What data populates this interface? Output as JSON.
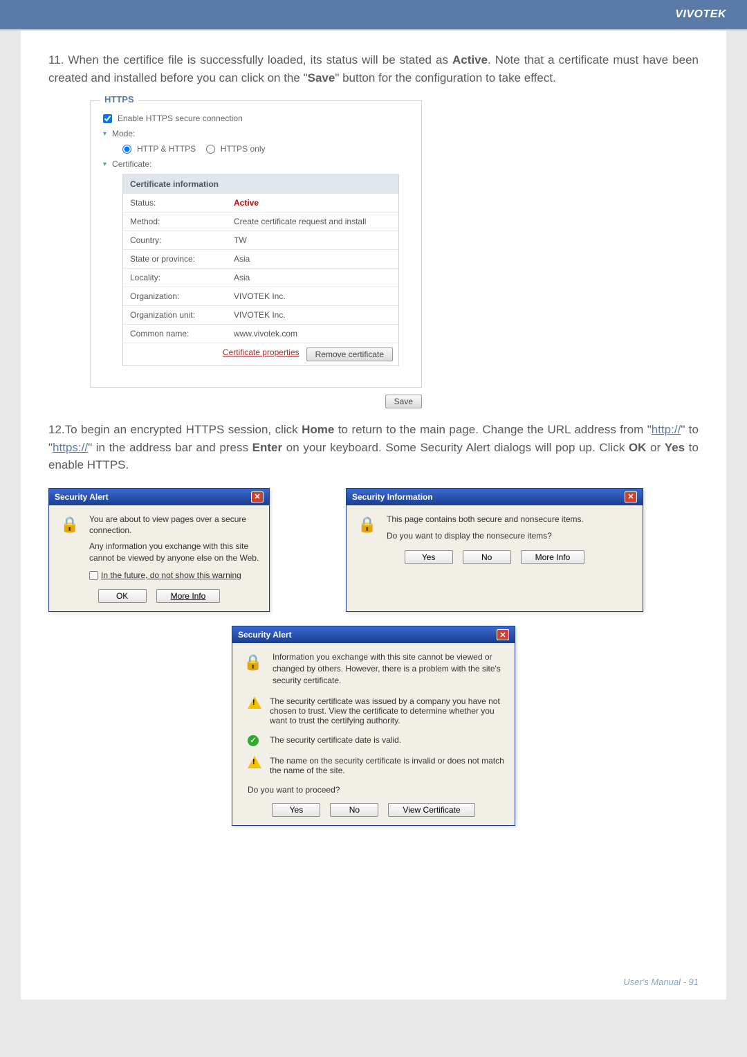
{
  "brand": "VIVOTEK",
  "step11": {
    "num": "11.",
    "text_a": " When the certifice file is successfully loaded, its status will be stated as ",
    "active": "Active",
    "text_b": ". Note that a certificate must have been created and installed before you can click on the \"",
    "save": "Save",
    "text_c": "\" button for the configuration to take effect."
  },
  "https_panel": {
    "legend": "HTTPS",
    "enable_label": "Enable HTTPS secure connection",
    "mode_label": "Mode:",
    "mode_http_https": "HTTP & HTTPS",
    "mode_https_only": "HTTPS only",
    "cert_label": "Certificate:",
    "cert_header": "Certificate information",
    "rows": [
      {
        "k": "Status:",
        "v": "Active",
        "active": true
      },
      {
        "k": "Method:",
        "v": "Create certificate request and install"
      },
      {
        "k": "Country:",
        "v": "TW"
      },
      {
        "k": "State or province:",
        "v": "Asia"
      },
      {
        "k": "Locality:",
        "v": "Asia"
      },
      {
        "k": "Organization:",
        "v": "VIVOTEK Inc."
      },
      {
        "k": "Organization unit:",
        "v": "VIVOTEK Inc."
      },
      {
        "k": "Common name:",
        "v": "www.vivotek.com"
      }
    ],
    "link_cert_props": "Certificate properties",
    "btn_remove": "Remove certificate",
    "btn_save": "Save"
  },
  "step12": {
    "num": "12.",
    "a": "To begin an encrypted HTTPS session, click ",
    "home": "Home",
    "b": " to return to the main page. Change the URL address from \"",
    "http": "http://",
    "c": "\" to \"",
    "https": "https://",
    "d": "\" in the address bar and press ",
    "enter": "Enter",
    "e": " on your keyboard. Some Security Alert dialogs will pop up. Click ",
    "ok": "OK",
    "or": " or ",
    "yes": "Yes",
    "f": " to enable HTTPS."
  },
  "dlg1": {
    "title": "Security Alert",
    "line1": "You are about to view pages over a secure connection.",
    "line2": "Any information you exchange with this site cannot be viewed by anyone else on the Web.",
    "check": "In the future, do not show this warning",
    "ok": "OK",
    "more": "More Info"
  },
  "dlg2": {
    "title": "Security Information",
    "line1": "This page contains both secure and nonsecure items.",
    "line2": "Do you want to display the nonsecure items?",
    "yes": "Yes",
    "no": "No",
    "more": "More Info"
  },
  "dlg3": {
    "title": "Security Alert",
    "intro": "Information you exchange with this site cannot be viewed or changed by others. However, there is a problem with the site's security certificate.",
    "item1": "The security certificate was issued by a company you have not chosen to trust. View the certificate to determine whether you want to trust the certifying authority.",
    "item2": "The security certificate date is valid.",
    "item3": "The name on the security certificate is invalid or does not match the name of the site.",
    "proceed": "Do you want to proceed?",
    "yes": "Yes",
    "no": "No",
    "view": "View Certificate"
  },
  "footer": {
    "text": "User's Manual - ",
    "page": "91"
  }
}
